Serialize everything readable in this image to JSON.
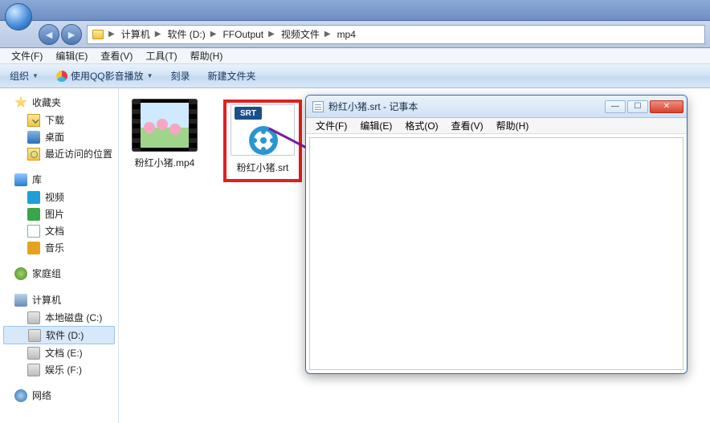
{
  "breadcrumb": {
    "root_icon": "folder-icon",
    "items": [
      "计算机",
      "软件 (D:)",
      "FFOutput",
      "视频文件",
      "mp4"
    ]
  },
  "menubar": {
    "items": [
      "文件(F)",
      "编辑(E)",
      "查看(V)",
      "工具(T)",
      "帮助(H)"
    ]
  },
  "toolbar": {
    "organize": "组织",
    "qqplay": "使用QQ影音播放",
    "burn": "刻录",
    "newfolder": "新建文件夹"
  },
  "sidebar": {
    "favorites": {
      "label": "收藏夹",
      "items": [
        "下载",
        "桌面",
        "最近访问的位置"
      ]
    },
    "libraries": {
      "label": "库",
      "items": [
        "视频",
        "图片",
        "文档",
        "音乐"
      ]
    },
    "homegroup": {
      "label": "家庭组"
    },
    "computer": {
      "label": "计算机",
      "drives": [
        "本地磁盘 (C:)",
        "软件 (D:)",
        "文档 (E:)",
        "娱乐 (F:)"
      ],
      "selected_index": 1
    },
    "network": {
      "label": "网络"
    }
  },
  "files": {
    "video": {
      "name": "粉红小猪.mp4"
    },
    "srt": {
      "name": "粉红小猪.srt",
      "badge": "SRT"
    }
  },
  "notepad": {
    "title": "粉红小猪.srt - 记事本",
    "menu": [
      "文件(F)",
      "编辑(E)",
      "格式(O)",
      "查看(V)",
      "帮助(H)"
    ],
    "minimize": "—",
    "maximize": "☐",
    "close": "✕"
  }
}
